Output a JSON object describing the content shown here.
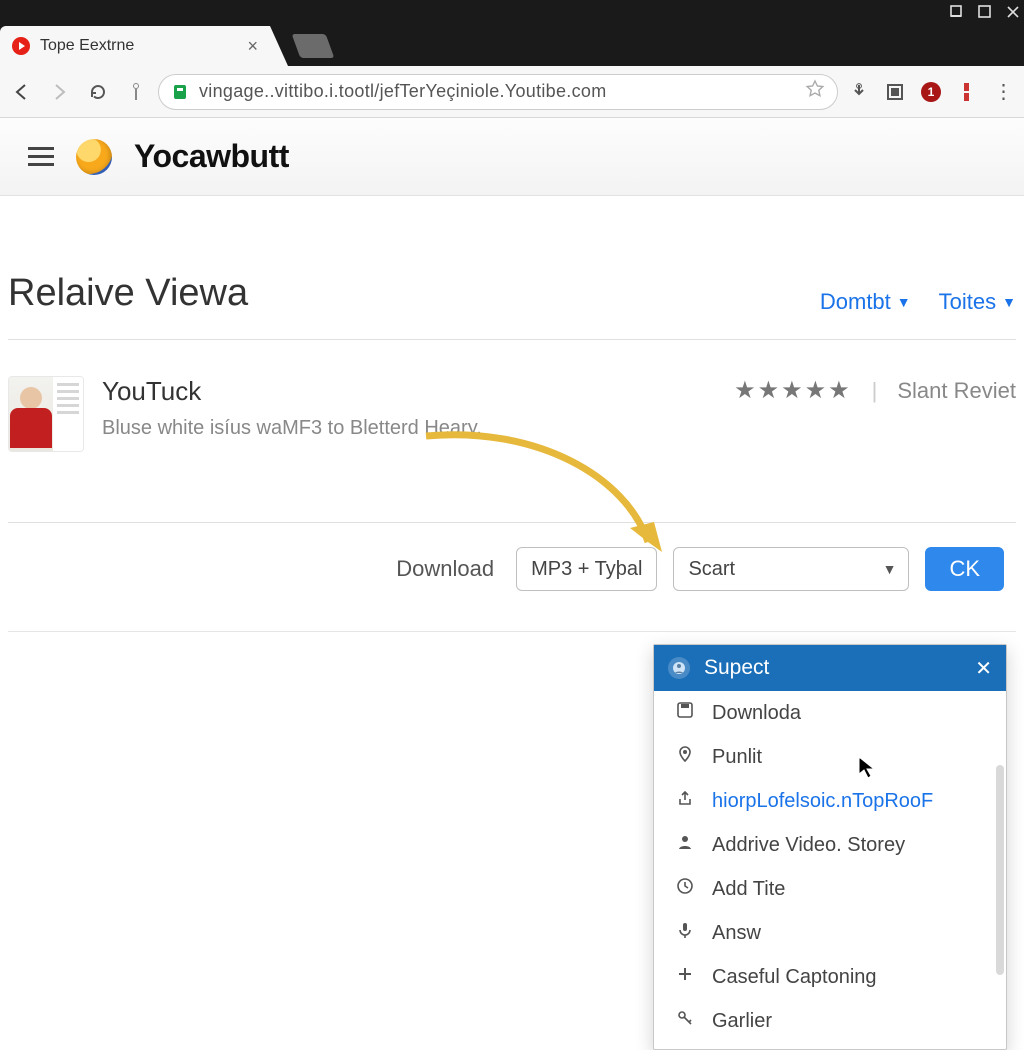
{
  "window": {
    "tab": {
      "title": "Tope Eextrne"
    },
    "url": "vingage..vittibo.i.tootl/jefTerYeçiniole.Youtibe.com",
    "ext_badge": "1"
  },
  "brand": {
    "name": "Yocawbutt"
  },
  "page": {
    "title": "Relaive Viewa",
    "dropdowns": {
      "primary": "Domtbt",
      "secondary": "Toites"
    }
  },
  "item": {
    "title": "YouTuck",
    "subtitle": "Bluse white isíus waMF3 to Bletterd Heary.",
    "review_link": "Slant Reviet"
  },
  "actions": {
    "download_label": "Download",
    "format_pill": "MP3 + Tyþal",
    "select_value": "Scart",
    "ok_label": "CK"
  },
  "dropdown": {
    "header": "Supect",
    "items": [
      {
        "icon": "save-icon",
        "label": "Downloda",
        "link": false
      },
      {
        "icon": "pin-icon",
        "label": "Punlit",
        "link": false
      },
      {
        "icon": "share-icon",
        "label": "hiorpLofelsoic.nTopRooF",
        "link": true
      },
      {
        "icon": "person-icon",
        "label": "Addrive Video. Storey",
        "link": false
      },
      {
        "icon": "clock-icon",
        "label": "Add Tite",
        "link": false
      },
      {
        "icon": "mic-icon",
        "label": "Answ",
        "link": false
      },
      {
        "icon": "plus-icon",
        "label": "Caseful Captoning",
        "link": false
      },
      {
        "icon": "key-icon",
        "label": "Garlier",
        "link": false
      }
    ]
  }
}
